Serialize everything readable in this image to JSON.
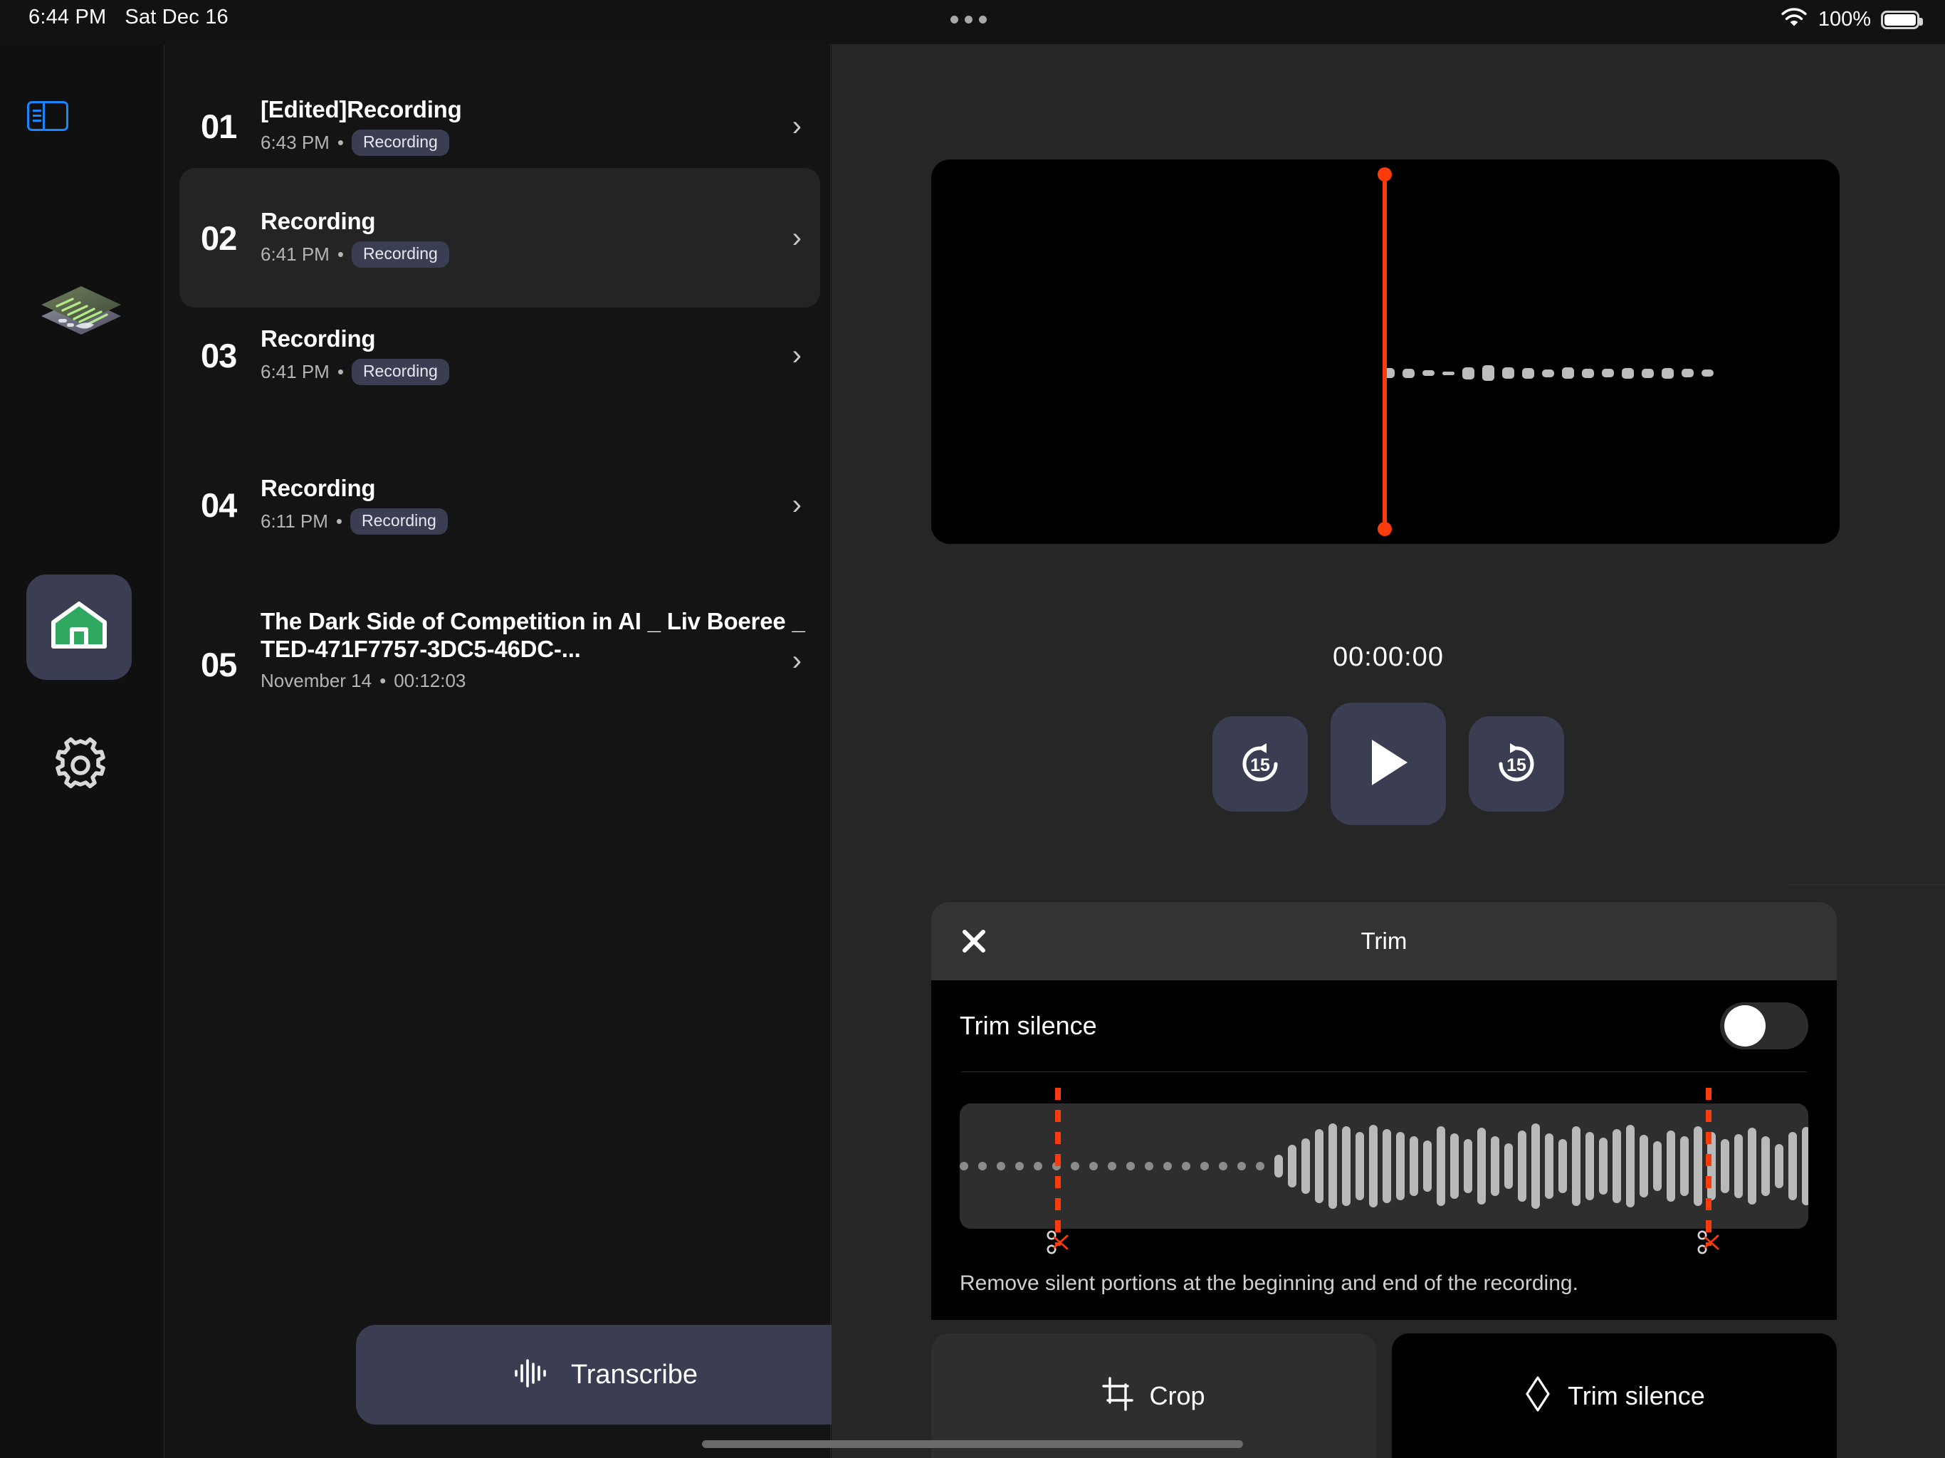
{
  "status_bar": {
    "time": "6:44 PM",
    "date": "Sat Dec 16",
    "battery_percent": "100%",
    "wifi_icon": "wifi-icon",
    "battery_icon": "battery-full-icon",
    "multitask_icon": "multitask-dots-icon"
  },
  "rail": {
    "toggle_icon": "sidebar-toggle-icon",
    "app_logo_icon": "app-logo-icon",
    "home_icon": "home-icon",
    "settings_icon": "gear-icon"
  },
  "recordings": [
    {
      "num": "01",
      "title": "[Edited]Recording",
      "time": "6:43 PM",
      "separator": "•",
      "badge": "Recording",
      "chevron": "›",
      "selected": false,
      "lines": 1
    },
    {
      "num": "02",
      "title": "Recording",
      "time": "6:41 PM",
      "separator": "•",
      "badge": "Recording",
      "chevron": "›",
      "selected": true,
      "lines": 1
    },
    {
      "num": "03",
      "title": "Recording",
      "time": "6:41 PM",
      "separator": "•",
      "badge": "Recording",
      "chevron": "›",
      "selected": false,
      "lines": 1
    },
    {
      "num": "04",
      "title": "Recording",
      "time": "6:11 PM",
      "separator": "•",
      "badge": "Recording",
      "chevron": "›",
      "selected": false,
      "lines": 1
    },
    {
      "num": "05",
      "title": "The Dark Side of Competition in AI _ Liv Boeree _ TED-471F7757-3DC5-46DC-...",
      "time": "November 14",
      "separator": "•",
      "badge": "",
      "duration": "00:12:03",
      "chevron": "›",
      "selected": false,
      "lines": 2
    }
  ],
  "list_actions": {
    "transcribe_label": "Transcribe",
    "transcribe_icon": "waveform-icon",
    "record_icon": "microphone-icon"
  },
  "player": {
    "timecode": "00:00:00",
    "play_icon": "play-icon",
    "rewind_icon": "rewind-15-icon",
    "forward_icon": "forward-15-icon",
    "skip_seconds": "15",
    "playhead_color": "#fb3b09",
    "waveform_color": "#bdbdbd"
  },
  "trim_sheet": {
    "title": "Trim",
    "close_icon": "close-icon",
    "toggle_label": "Trim silence",
    "toggle_on": false,
    "description": "Remove silent portions at the beginning and end of the recording.",
    "cut_marker_icon": "scissors-icon",
    "cut_color": "#fb3b09"
  },
  "action_bar": {
    "buttons": [
      {
        "label": "Crop",
        "icon": "crop-icon",
        "active": false
      },
      {
        "label": "Trim silence",
        "icon": "diamond-icon",
        "active": true
      }
    ]
  },
  "chart_data": {
    "type": "bar",
    "title": "Player preview waveform",
    "values": [
      14,
      13,
      8,
      5,
      17,
      22,
      16,
      15,
      11,
      16,
      13,
      12,
      15,
      13,
      15,
      12,
      10
    ],
    "ylim": [
      0,
      24
    ]
  },
  "trim_waveform": {
    "type": "bar",
    "title": "Trim editor waveform",
    "dotted_left_count": 17,
    "dotted_right_count": 20,
    "values": [
      32,
      60,
      78,
      104,
      120,
      112,
      96,
      116,
      104,
      96,
      84,
      72,
      112,
      92,
      76,
      108,
      84,
      64,
      100,
      120,
      92,
      76,
      112,
      96,
      80,
      104,
      116,
      88,
      70,
      100,
      84,
      112,
      96,
      76,
      90,
      108,
      84,
      62,
      96,
      110,
      88,
      72,
      100,
      86,
      64,
      92,
      54
    ]
  }
}
